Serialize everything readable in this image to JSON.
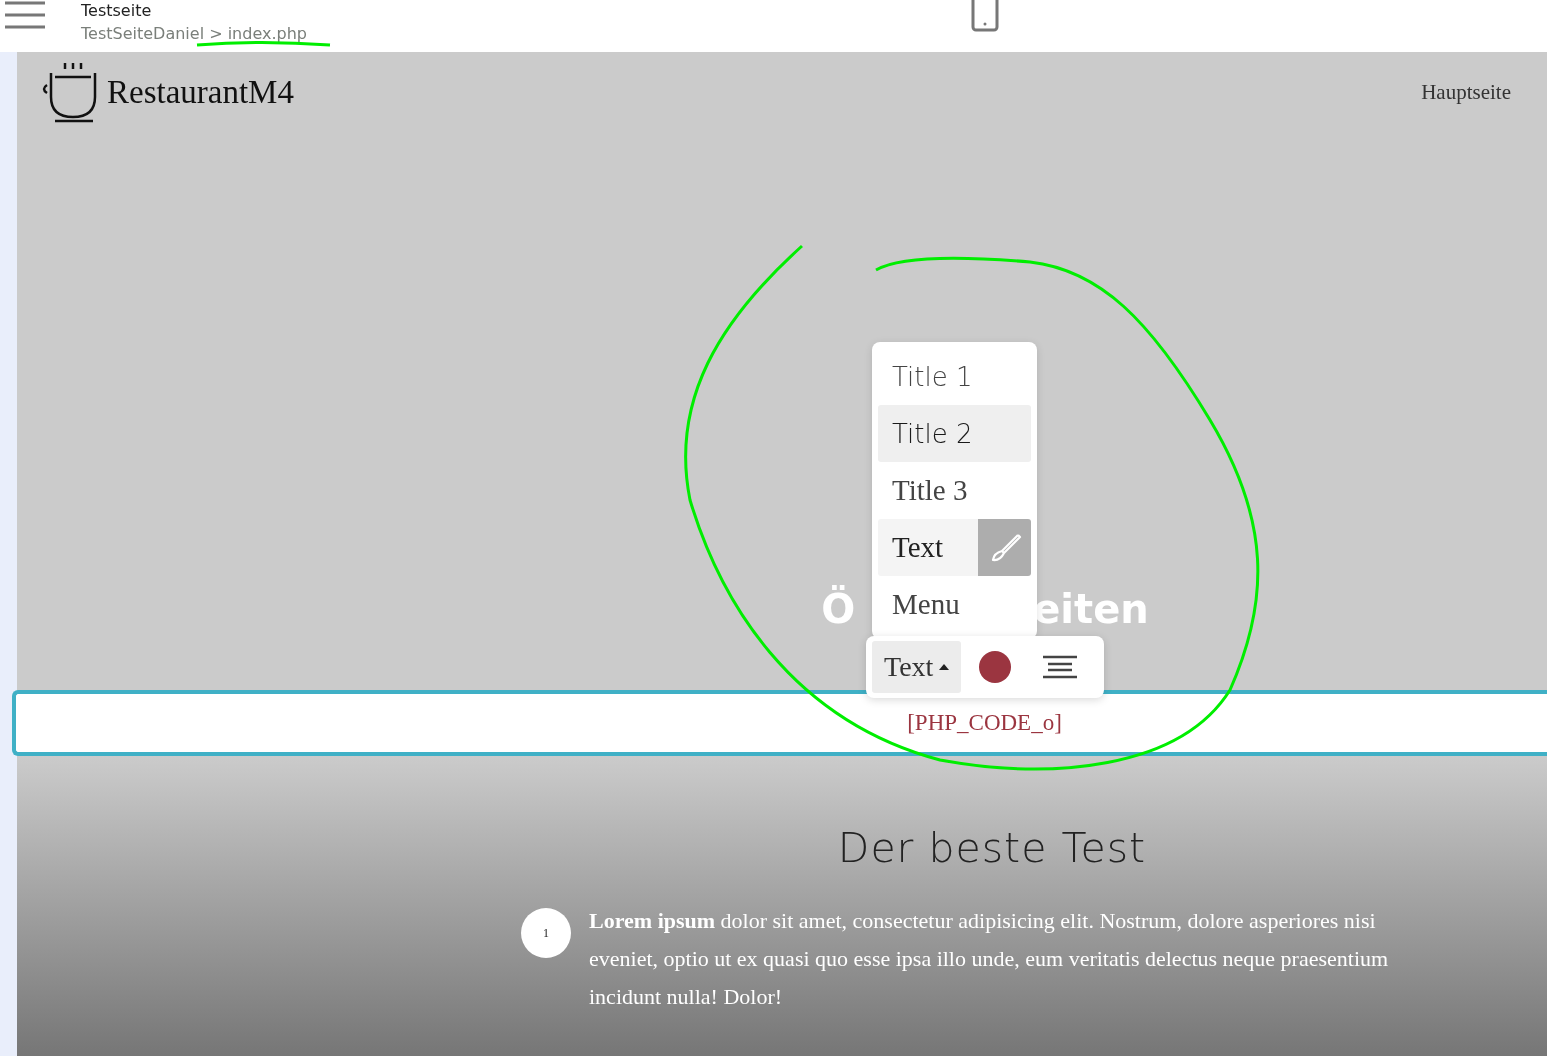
{
  "top_bar": {
    "title": "Testseite",
    "breadcrumb": "TestSeiteDaniel > index.php"
  },
  "site": {
    "brand": "RestaurantM4",
    "nav": [
      {
        "label": "Hauptseite"
      }
    ]
  },
  "hero": {
    "heading_left": "Ö",
    "heading_right": "eiten"
  },
  "style_menu": {
    "items": [
      {
        "label": "Title 1",
        "kind": "title1",
        "selected": false,
        "hovered": false
      },
      {
        "label": "Title 2",
        "kind": "title2",
        "selected": false,
        "hovered": true
      },
      {
        "label": "Title 3",
        "kind": "title3",
        "selected": false,
        "hovered": false
      },
      {
        "label": "Text",
        "kind": "text",
        "selected": true,
        "hovered": false
      },
      {
        "label": "Menu",
        "kind": "menu",
        "selected": false,
        "hovered": false
      }
    ]
  },
  "toolbar": {
    "style_button": "Text",
    "color": "#9b3540"
  },
  "editable_block": {
    "code": "[PHP_CODE_o]"
  },
  "section": {
    "heading": "Der beste Test",
    "items": [
      {
        "number": "1",
        "text": "**Lorem ipsum** dolor sit amet, consectetur adipisicing elit. Nostrum, dolore asperiores nisi eveniet, optio ut ex quasi quo esse ipsa illo unde, eum veritatis delectus neque praesentium incidunt nulla! Dolor!"
      }
    ]
  }
}
